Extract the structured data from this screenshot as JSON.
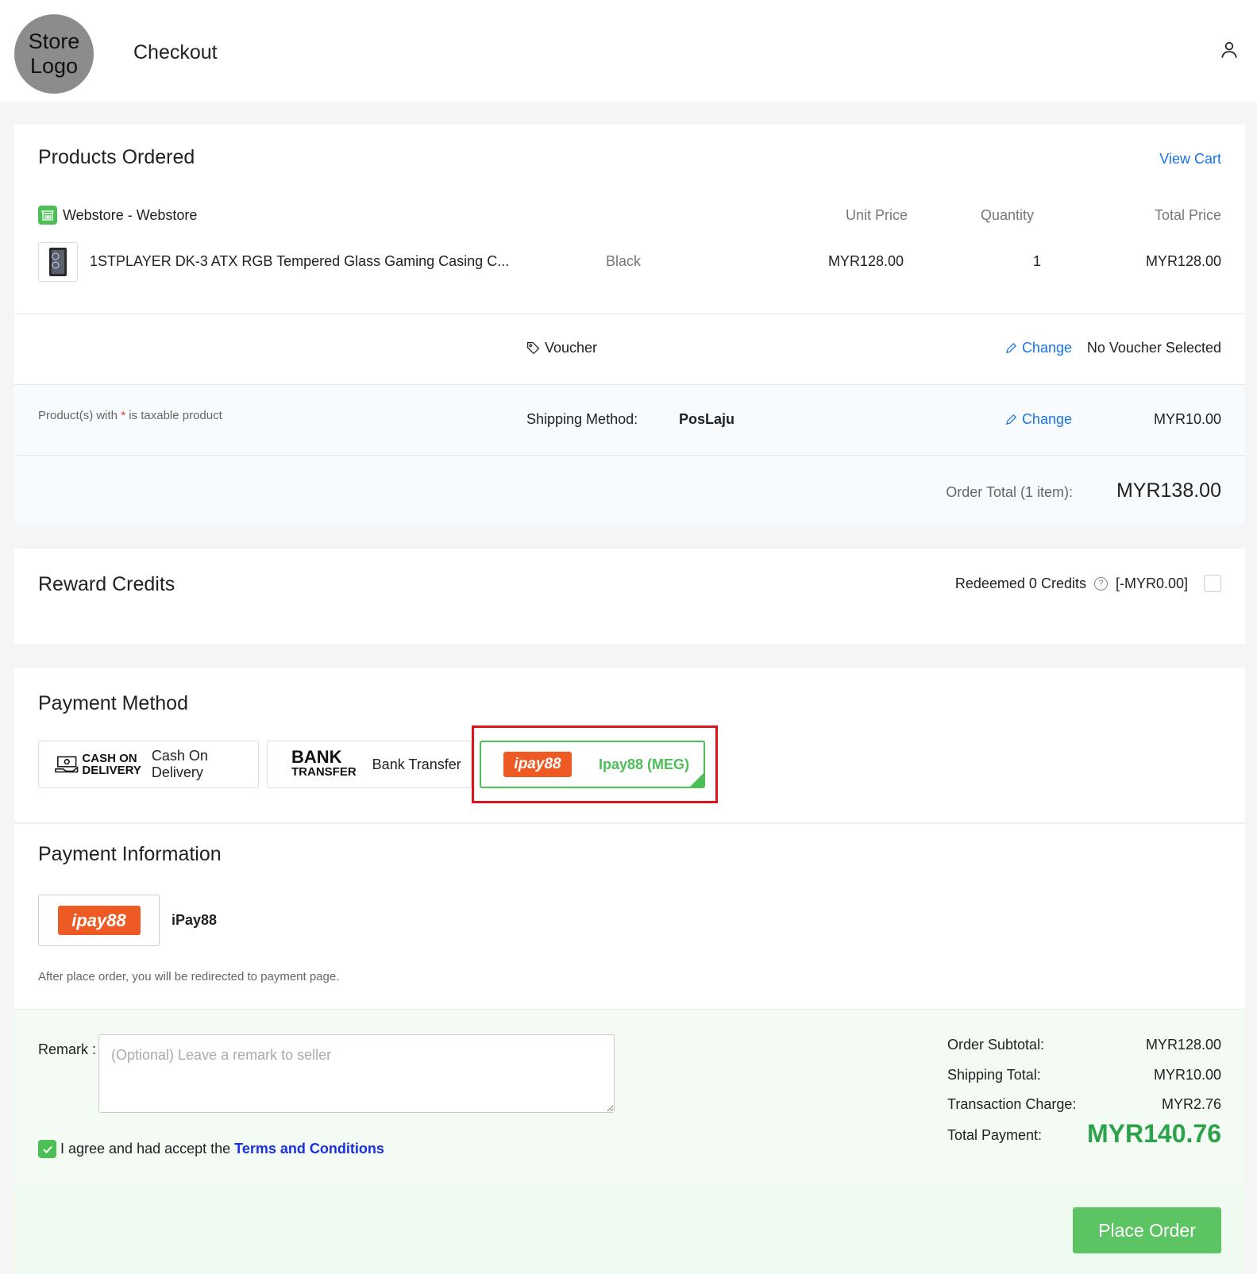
{
  "header": {
    "logo_text": "Store Logo",
    "title": "Checkout",
    "user_icon": "user-icon"
  },
  "products": {
    "title": "Products Ordered",
    "view_cart": "View Cart",
    "store_name": "Webstore - Webstore",
    "col_unit_price": "Unit Price",
    "col_quantity": "Quantity",
    "col_total_price": "Total Price",
    "items": [
      {
        "name": "1STPLAYER DK-3 ATX RGB Tempered Glass Gaming Casing C...",
        "variant": "Black",
        "unit_price": "MYR128.00",
        "quantity": "1",
        "total_price": "MYR128.00"
      }
    ],
    "voucher_label": "Voucher",
    "voucher_change": "Change",
    "voucher_value": "No Voucher Selected",
    "tax_note_prefix": "Product(s) with ",
    "tax_note_star": "*",
    "tax_note_suffix": " is taxable product",
    "shipping_label": "Shipping Method:",
    "shipping_name": "PosLaju",
    "shipping_change": "Change",
    "shipping_price": "MYR10.00",
    "order_total_label": "Order Total (1 item):",
    "order_total_value": "MYR138.00"
  },
  "rewards": {
    "title": "Reward Credits",
    "redeemed_text": "Redeemed 0 Credits",
    "redeemed_value": "[-MYR0.00]"
  },
  "payment": {
    "title": "Payment Method",
    "options": [
      {
        "logo_line1": "CASH ON",
        "logo_line2": "DELIVERY",
        "label": "Cash On Delivery"
      },
      {
        "logo_line1": "BANK",
        "logo_line2": "TRANSFER",
        "label": "Bank Transfer"
      },
      {
        "logo": "ipay88",
        "label": "Ipay88 (MEG)",
        "selected": true
      }
    ],
    "info_title": "Payment Information",
    "info_logo": "ipay88",
    "info_name": "iPay88",
    "info_note": "After place order, you will be redirected to payment page."
  },
  "summary": {
    "remark_label": "Remark",
    "remark_placeholder": "(Optional) Leave a remark to seller",
    "agree_text": "I agree and had accept the",
    "terms_link": "Terms and Conditions",
    "subtotal_label": "Order Subtotal:",
    "subtotal_value": "MYR128.00",
    "shipping_label": "Shipping Total:",
    "shipping_value": "MYR10.00",
    "transaction_label": "Transaction Charge:",
    "transaction_value": "MYR2.76",
    "total_label": "Total Payment:",
    "total_value": "MYR140.76"
  },
  "place_order": "Place Order",
  "colors": {
    "accent_green": "#4cbf56",
    "link_blue": "#1a73e8",
    "highlight_red": "#e0121b",
    "ipay_orange": "#ee5a24"
  }
}
